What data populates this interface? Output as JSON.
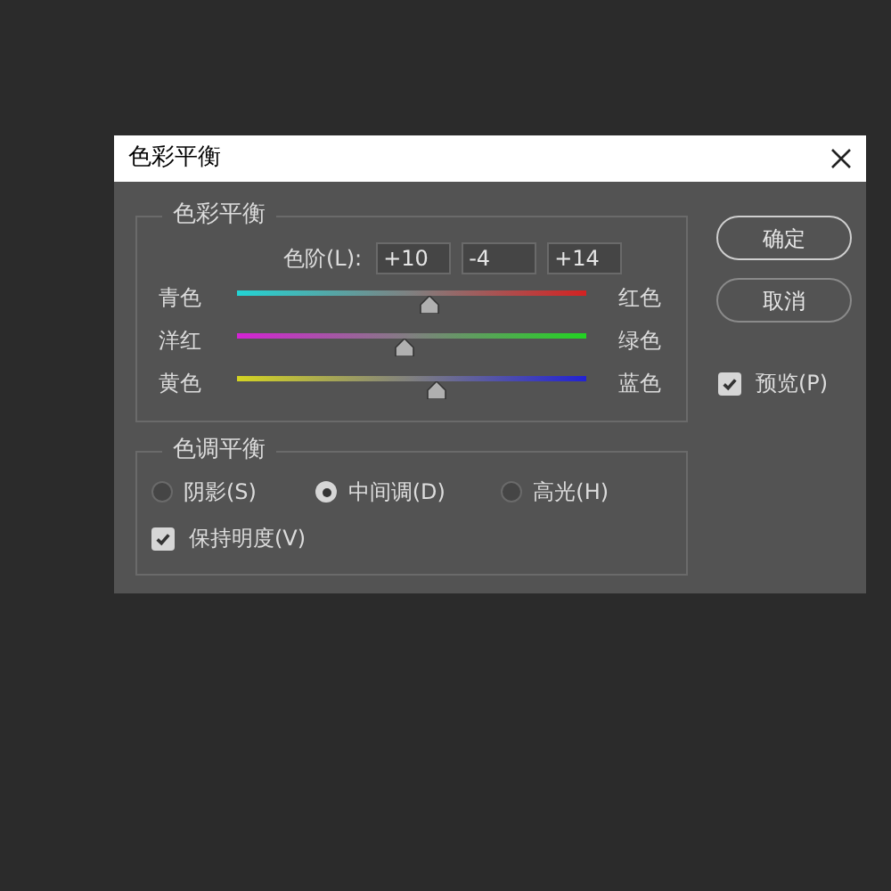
{
  "window": {
    "title": "色彩平衡"
  },
  "color_balance": {
    "title": "色彩平衡",
    "levels_label": "色阶(L):",
    "levels": [
      "+10",
      "-4",
      "+14"
    ],
    "sliders": [
      {
        "left": "青色",
        "right": "红色",
        "kind": "cyan_red",
        "level": 0.55
      },
      {
        "left": "洋红",
        "right": "绿色",
        "kind": "magenta_green",
        "level": 0.48
      },
      {
        "left": "黄色",
        "right": "蓝色",
        "kind": "yellow_blue",
        "level": 0.57
      }
    ]
  },
  "tone_balance": {
    "title": "色调平衡",
    "options": [
      {
        "label": "阴影(S)",
        "selected": false
      },
      {
        "label": "中间调(D)",
        "selected": true
      },
      {
        "label": "高光(H)",
        "selected": false
      }
    ],
    "preserve_luminosity": {
      "label": "保持明度(V)",
      "checked": true
    }
  },
  "buttons": [
    "确定",
    "取消"
  ],
  "preview": {
    "label": "预览(P)",
    "checked": true
  }
}
